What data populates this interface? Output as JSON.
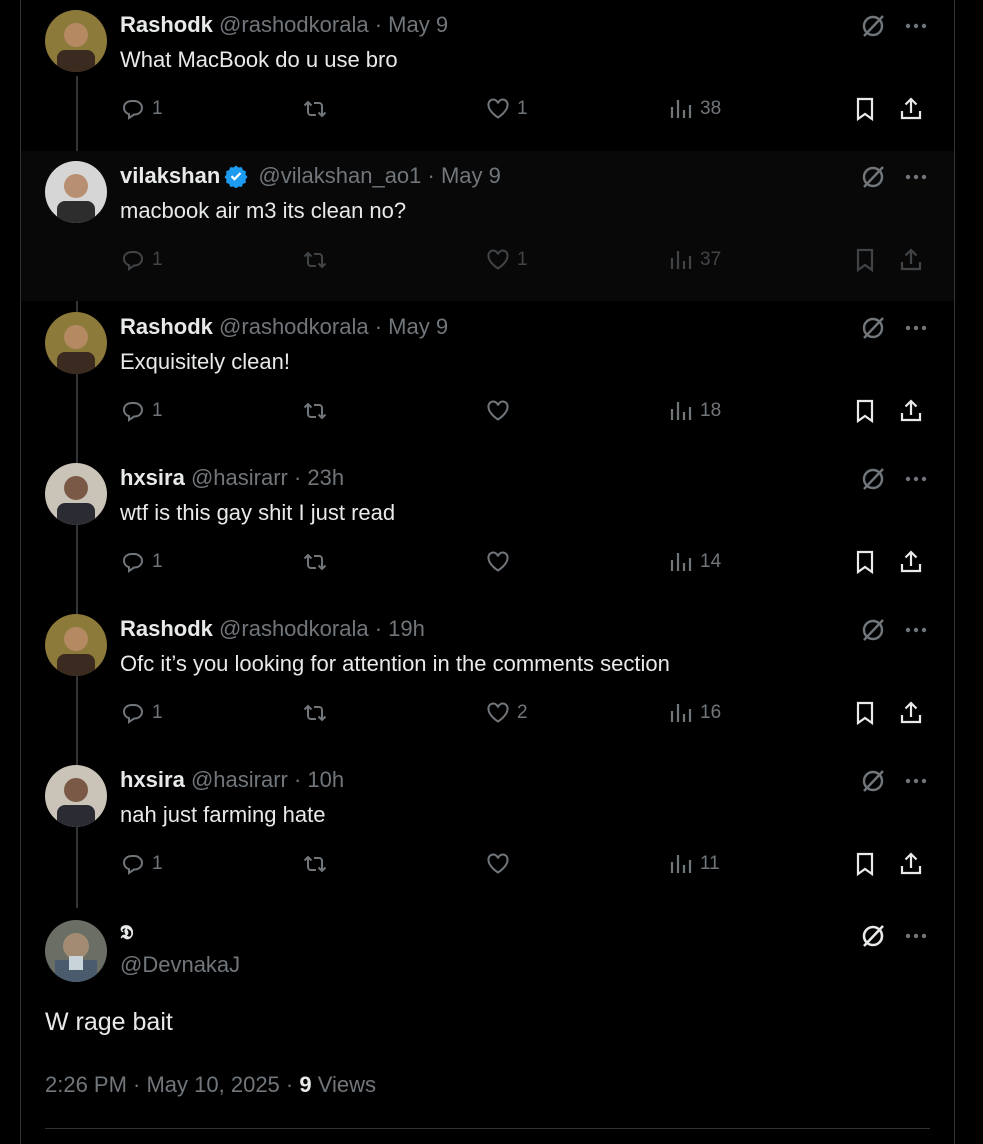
{
  "tweets": [
    {
      "name": "Rashodk",
      "handle": "@rashodkorala",
      "time": "May 9",
      "text": "What MacBook do u use bro",
      "replies": "1",
      "reposts": "",
      "likes": "1",
      "views": "38",
      "verified": false
    },
    {
      "name": "vilakshan",
      "handle": "@vilakshan_ao1",
      "time": "May 9",
      "text": "macbook air m3 its clean no?",
      "replies": "1",
      "reposts": "",
      "likes": "1",
      "views": "37",
      "verified": true
    },
    {
      "name": "Rashodk",
      "handle": "@rashodkorala",
      "time": "May 9",
      "text": "Exquisitely clean!",
      "replies": "1",
      "reposts": "",
      "likes": "",
      "views": "18",
      "verified": false
    },
    {
      "name": "hxsira",
      "handle": "@hasirarr",
      "time": "23h",
      "text": "wtf is this gay shit I just read",
      "replies": "1",
      "reposts": "",
      "likes": "",
      "views": "14",
      "verified": false
    },
    {
      "name": "Rashodk",
      "handle": "@rashodkorala",
      "time": "19h",
      "text": "Ofc it’s you looking for attention in the comments section",
      "replies": "1",
      "reposts": "",
      "likes": "2",
      "views": "16",
      "verified": false
    },
    {
      "name": "hxsira",
      "handle": "@hasirarr",
      "time": "10h",
      "text": "nah just farming hate",
      "replies": "1",
      "reposts": "",
      "likes": "",
      "views": "11",
      "verified": false
    }
  ],
  "main": {
    "name": "𝕯",
    "handle": "@DevnakaJ",
    "text": "W rage bait",
    "timestamp": "2:26 PM · May 10, 2025 · ",
    "views_count": "9",
    "views_label": " Views"
  },
  "separator": " · ",
  "colors": {
    "background": "#000000",
    "text": "#e7e9ea",
    "muted": "#71767b",
    "verified": "#1d9bf0",
    "line": "#333639"
  },
  "icons": {
    "reply": "reply-icon",
    "repost": "repost-icon",
    "like": "heart-icon",
    "views": "views-icon",
    "bookmark": "bookmark-icon",
    "share": "share-icon",
    "grok": "grok-icon",
    "more": "more-icon"
  }
}
